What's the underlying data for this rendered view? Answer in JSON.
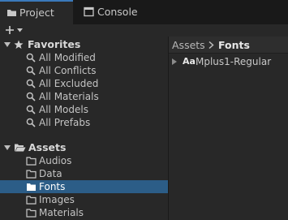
{
  "tabs": [
    {
      "label": "Project",
      "icon": "folder-icon"
    },
    {
      "label": "Console",
      "icon": "console-icon"
    }
  ],
  "toolbar": {
    "add_label": "+",
    "add_icon": "plus-icon",
    "dropdown_icon": "caret-down-icon"
  },
  "tree": {
    "favorites": {
      "label": "Favorites",
      "icon": "star-icon",
      "items": [
        {
          "label": "All Modified"
        },
        {
          "label": "All Conflicts"
        },
        {
          "label": "All Excluded"
        },
        {
          "label": "All Materials"
        },
        {
          "label": "All Models"
        },
        {
          "label": "All Prefabs"
        }
      ]
    },
    "assets": {
      "label": "Assets",
      "icon": "open-folder-icon",
      "items": [
        {
          "label": "Audios"
        },
        {
          "label": "Data"
        },
        {
          "label": "Fonts",
          "selected": true
        },
        {
          "label": "Images"
        },
        {
          "label": "Materials"
        }
      ]
    }
  },
  "breadcrumb": {
    "root": "Assets",
    "current": "Fonts"
  },
  "files": [
    {
      "badge": "Aa",
      "label": "Mplus1-Regular"
    }
  ],
  "colors": {
    "background": "#282828",
    "tabbar": "#191919",
    "selection": "#2c5d87",
    "active_tab_accent": "#3a79bb",
    "text": "#c4c4c4"
  }
}
